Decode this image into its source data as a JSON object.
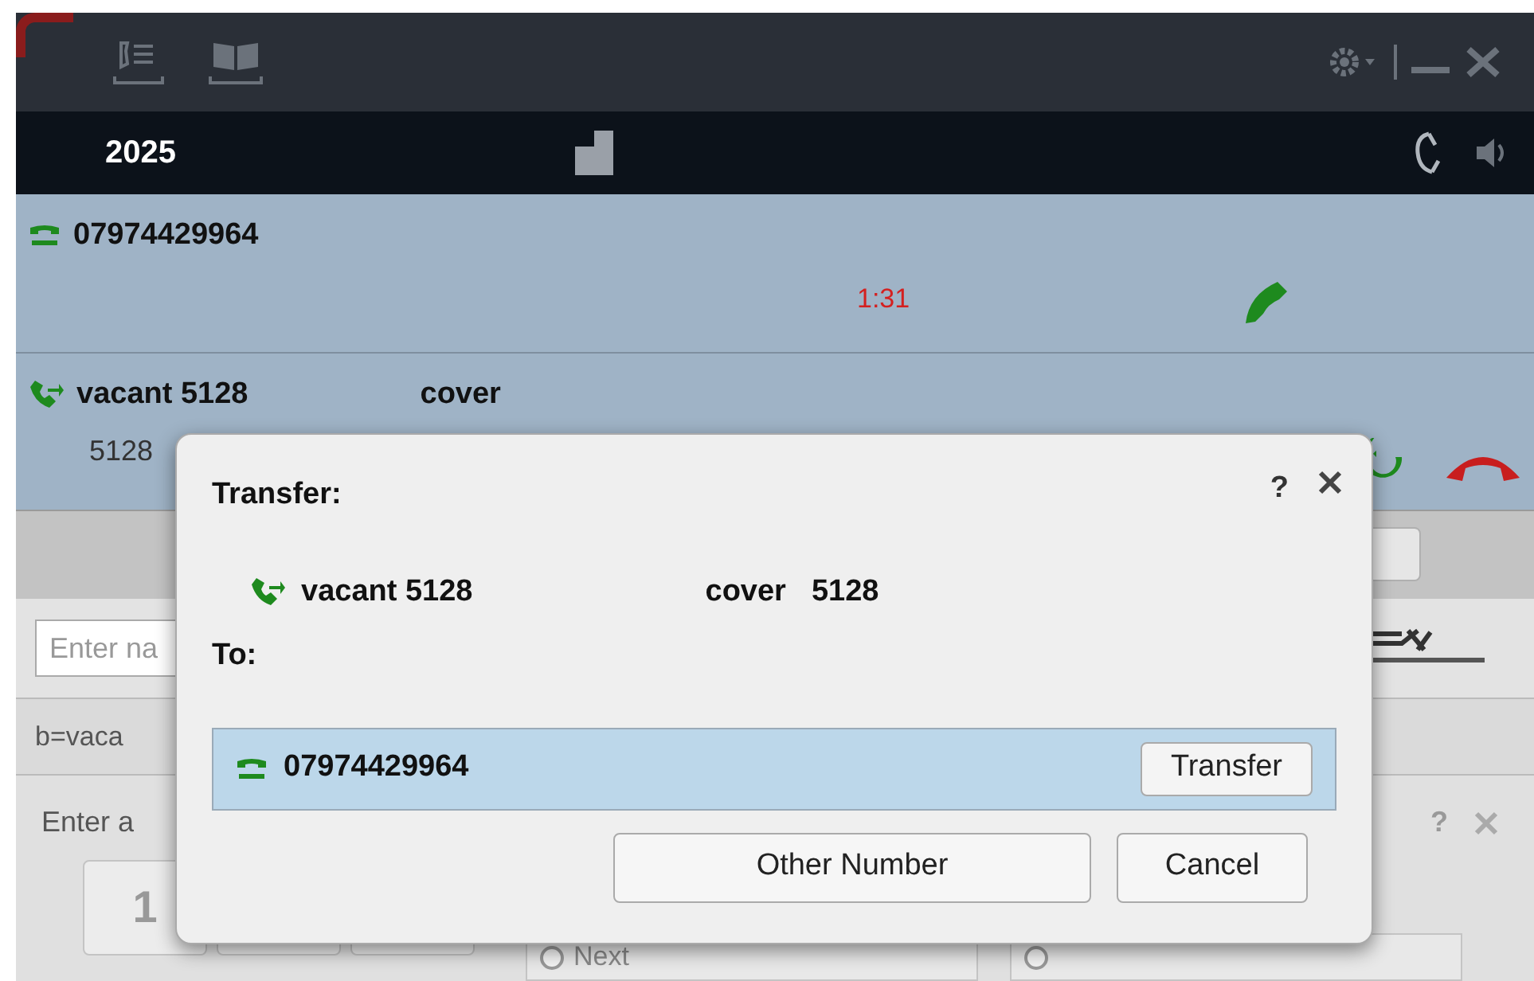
{
  "header": {
    "extension": "2025"
  },
  "calls": [
    {
      "kind": "external",
      "number": "07974429964",
      "timer": "1:31"
    },
    {
      "kind": "transferred",
      "name": "vacant 5128",
      "label": "cover",
      "number": "5128"
    }
  ],
  "search": {
    "placeholder": "Enter na"
  },
  "status_text": "b=vaca",
  "dial_panel": {
    "prompt": "Enter a",
    "help": "?",
    "keys": [
      "1"
    ],
    "options": [
      {
        "label": "Next",
        "selected": false
      },
      {
        "selected": false
      }
    ]
  },
  "dialog": {
    "title": "Transfer:",
    "help": "?",
    "call": {
      "name": "vacant 5128",
      "label": "cover",
      "number": "5128"
    },
    "to_label": "To:",
    "targets": [
      {
        "number": "07974429964",
        "action": "Transfer",
        "selected": true
      }
    ],
    "buttons": [
      "Other Number",
      "Cancel"
    ]
  }
}
